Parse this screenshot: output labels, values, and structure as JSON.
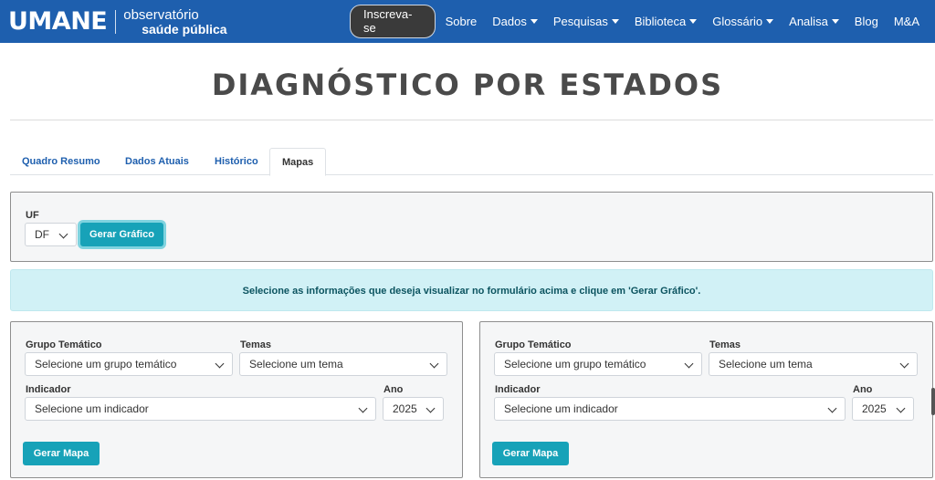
{
  "brand": {
    "logo": "UMANE",
    "line1": "observatório",
    "line2": "saúde pública"
  },
  "nav": {
    "subscribe": "Inscreva-se",
    "items": [
      {
        "label": "Sobre",
        "dropdown": false
      },
      {
        "label": "Dados",
        "dropdown": true
      },
      {
        "label": "Pesquisas",
        "dropdown": true
      },
      {
        "label": "Biblioteca",
        "dropdown": true
      },
      {
        "label": "Glossário",
        "dropdown": true
      },
      {
        "label": "Analisa",
        "dropdown": true
      },
      {
        "label": "Blog",
        "dropdown": false
      },
      {
        "label": "M&A",
        "dropdown": false
      }
    ]
  },
  "page": {
    "title": "DIAGNÓSTICO POR ESTADOS"
  },
  "tabs": [
    {
      "label": "Quadro Resumo",
      "active": false
    },
    {
      "label": "Dados Atuais",
      "active": false
    },
    {
      "label": "Histórico",
      "active": false
    },
    {
      "label": "Mapas",
      "active": true
    }
  ],
  "uf_form": {
    "label": "UF",
    "selected": "DF",
    "button": "Gerar Gráfico"
  },
  "alert": {
    "text": "Selecione as informações que deseja visualizar no formulário acima e clique em 'Gerar Gráfico'."
  },
  "map_panels": [
    {
      "group_label": "Grupo Temático",
      "group_value": "Selecione um grupo temático",
      "theme_label": "Temas",
      "theme_value": "Selecione um tema",
      "indicator_label": "Indicador",
      "indicator_value": "Selecione um indicador",
      "year_label": "Ano",
      "year_value": "2025",
      "button": "Gerar Mapa"
    },
    {
      "group_label": "Grupo Temático",
      "group_value": "Selecione um grupo temático",
      "theme_label": "Temas",
      "theme_value": "Selecione um tema",
      "indicator_label": "Indicador",
      "indicator_value": "Selecione um indicador",
      "year_label": "Ano",
      "year_value": "2025",
      "button": "Gerar Mapa"
    }
  ],
  "colors": {
    "navbar": "#1e5fae",
    "accent": "#17a2b8",
    "alert_bg": "#d1f1f6"
  }
}
